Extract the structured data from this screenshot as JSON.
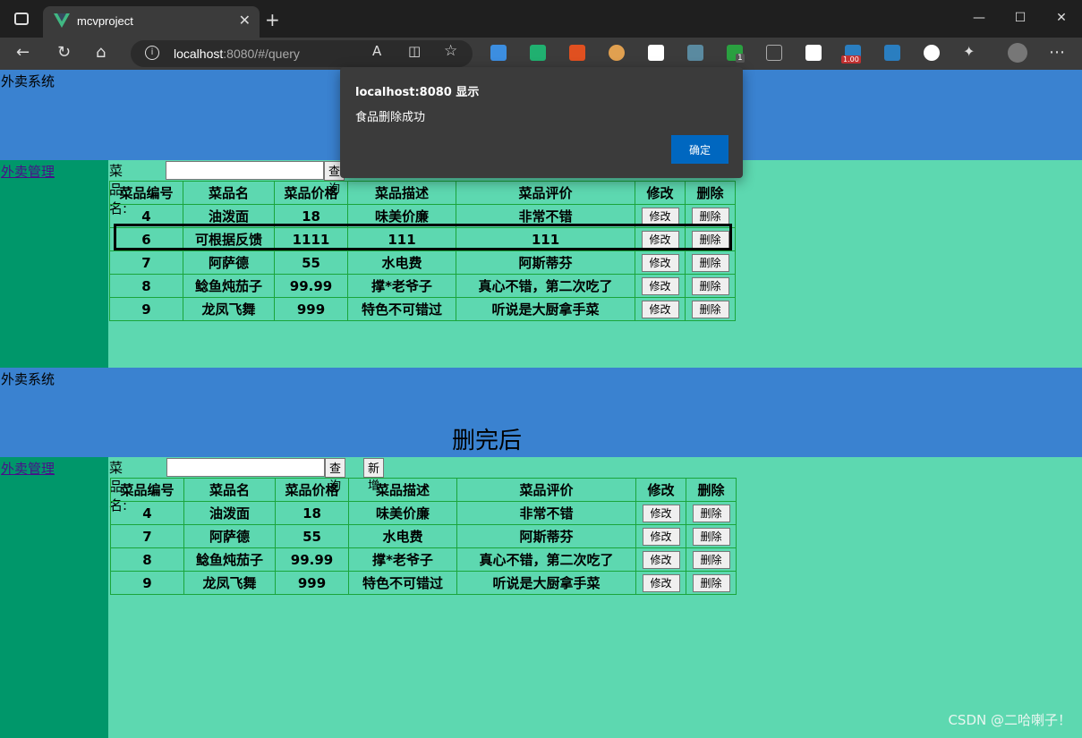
{
  "browser": {
    "tab_title": "mcvproject",
    "url_host": "localhost",
    "url_rest": ":8080/#/query",
    "badge_count": "1",
    "badge_price": "1.00"
  },
  "dialog": {
    "title": "localhost:8080 显示",
    "message": "食品删除成功",
    "ok_label": "确定"
  },
  "site_title": "外卖系统",
  "nav_link": "外卖管理",
  "search": {
    "label": "菜品名:",
    "query_label": "查询",
    "add_label": "新增"
  },
  "columns": [
    "菜品编号",
    "菜品名",
    "菜品价格",
    "菜品描述",
    "菜品评价",
    "修改",
    "删除"
  ],
  "edit_label": "修改",
  "delete_label": "删除",
  "before_rows": [
    [
      "4",
      "油泼面",
      "18",
      "味美价廉",
      "非常不错"
    ],
    [
      "6",
      "可根据反馈",
      "1111",
      "111",
      "111"
    ],
    [
      "7",
      "阿萨德",
      "55",
      "水电费",
      "阿斯蒂芬"
    ],
    [
      "8",
      "鲶鱼炖茄子",
      "99.99",
      "撑*老爷子",
      "真心不错，第二次吃了"
    ],
    [
      "9",
      "龙凤飞舞",
      "999",
      "特色不可错过",
      "听说是大厨拿手菜"
    ]
  ],
  "after_label": "删完后",
  "after_rows": [
    [
      "4",
      "油泼面",
      "18",
      "味美价廉",
      "非常不错"
    ],
    [
      "7",
      "阿萨德",
      "55",
      "水电费",
      "阿斯蒂芬"
    ],
    [
      "8",
      "鲶鱼炖茄子",
      "99.99",
      "撑*老爷子",
      "真心不错，第二次吃了"
    ],
    [
      "9",
      "龙凤飞舞",
      "999",
      "特色不可错过",
      "听说是大厨拿手菜"
    ]
  ],
  "watermark": "CSDN @二哈喇子！"
}
